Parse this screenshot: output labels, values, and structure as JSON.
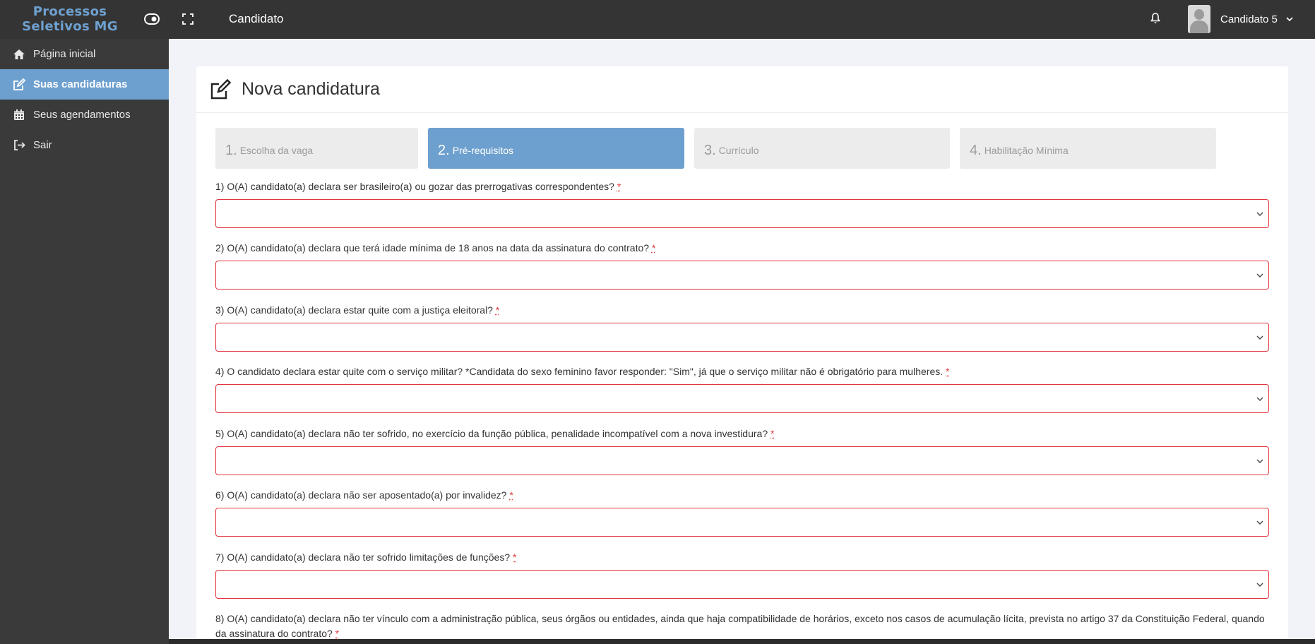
{
  "brand": {
    "line1": "Processos",
    "line2": "Seletivos MG"
  },
  "topbar": {
    "title": "Candidato",
    "user_name": "Candidato 5"
  },
  "sidebar": {
    "items": [
      {
        "label": "Página inicial",
        "icon": "home-icon"
      },
      {
        "label": "Suas candidaturas",
        "icon": "edit-icon",
        "active": true
      },
      {
        "label": "Seus agendamentos",
        "icon": "calendar-icon"
      },
      {
        "label": "Sair",
        "icon": "sign-out-icon"
      }
    ]
  },
  "page": {
    "title": "Nova candidatura"
  },
  "steps": [
    {
      "num": "1.",
      "label": "Escolha da vaga"
    },
    {
      "num": "2.",
      "label": "Pré-requisitos",
      "active": true
    },
    {
      "num": "3.",
      "label": "Currículo"
    },
    {
      "num": "4.",
      "label": "Habilitação Mínima"
    }
  ],
  "questions": [
    {
      "text": "1) O(A) candidato(a) declara ser brasileiro(a) ou gozar das prerrogativas correspondentes?",
      "required": "*",
      "value": ""
    },
    {
      "text": "2) O(A) candidato(a) declara que terá idade mínima de 18 anos na data da assinatura do contrato?",
      "required": "*",
      "value": ""
    },
    {
      "text": "3) O(A) candidato(a) declara estar quite com a justiça eleitoral?",
      "required": "*",
      "value": ""
    },
    {
      "text": "4) O candidato declara estar quite com o serviço militar? *Candidata do sexo feminino favor responder: \"Sim\", já que o serviço militar não é obrigatório para mulheres.",
      "required": "*",
      "value": ""
    },
    {
      "text": "5) O(A) candidato(a) declara não ter sofrido, no exercício da função pública, penalidade incompatível com a nova investidura?",
      "required": "*",
      "value": ""
    },
    {
      "text": "6) O(A) candidato(a) declara não ser aposentado(a) por invalidez?",
      "required": "*",
      "value": ""
    },
    {
      "text": "7) O(A) candidato(a) declara não ter sofrido limitações de funções?",
      "required": "*",
      "value": ""
    },
    {
      "text": "8) O(A) candidato(a) declara não ter vínculo com a administração pública, seus órgãos ou entidades, ainda que haja compatibilidade de horários, exceto nos casos de acumulação lícita, prevista no artigo 37 da Constituição Federal, quando da assinatura do contrato?",
      "required": "*",
      "value": ""
    }
  ],
  "colors": {
    "accent": "#6ea0cf",
    "topbar": "#343434",
    "sidebar": "#3a3a3a",
    "error_border": "#e3343f"
  }
}
